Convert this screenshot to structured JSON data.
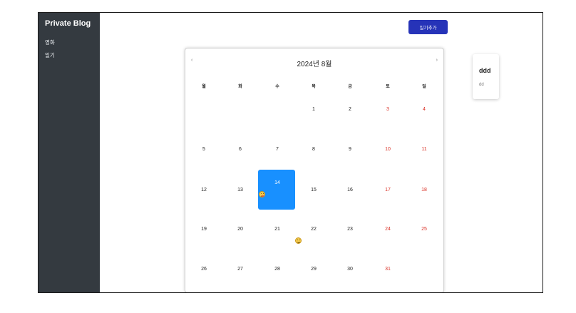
{
  "sidebar": {
    "brand": "Private Blog",
    "items": [
      {
        "label": "영화"
      },
      {
        "label": "일기"
      }
    ]
  },
  "toolbar": {
    "add_diary_label": "일기추가"
  },
  "calendar": {
    "title": "2024년 8월",
    "prev_label": "‹",
    "next_label": "›",
    "weekdays": [
      "월",
      "화",
      "수",
      "목",
      "금",
      "토",
      "일"
    ],
    "weeks": [
      [
        "",
        "",
        "",
        "1",
        "2",
        "3",
        "4"
      ],
      [
        "5",
        "6",
        "7",
        "8",
        "9",
        "10",
        "11"
      ],
      [
        "12",
        "13",
        "14",
        "15",
        "16",
        "17",
        "18"
      ],
      [
        "19",
        "20",
        "21",
        "22",
        "23",
        "24",
        "25"
      ],
      [
        "26",
        "27",
        "28",
        "29",
        "30",
        "31",
        ""
      ]
    ],
    "selected_day": "14",
    "weekend_color": "#d93025",
    "selected_color": "#1890ff",
    "day_markers": [
      {
        "day": "14",
        "icon": "tongue-out-emoji-icon"
      },
      {
        "day": "22",
        "icon": "smiling-emoji-icon"
      }
    ]
  },
  "card": {
    "title": "ddd",
    "body": "dd"
  },
  "colors": {
    "sidebar_bg": "#343a40",
    "button_bg": "#2633b8"
  }
}
